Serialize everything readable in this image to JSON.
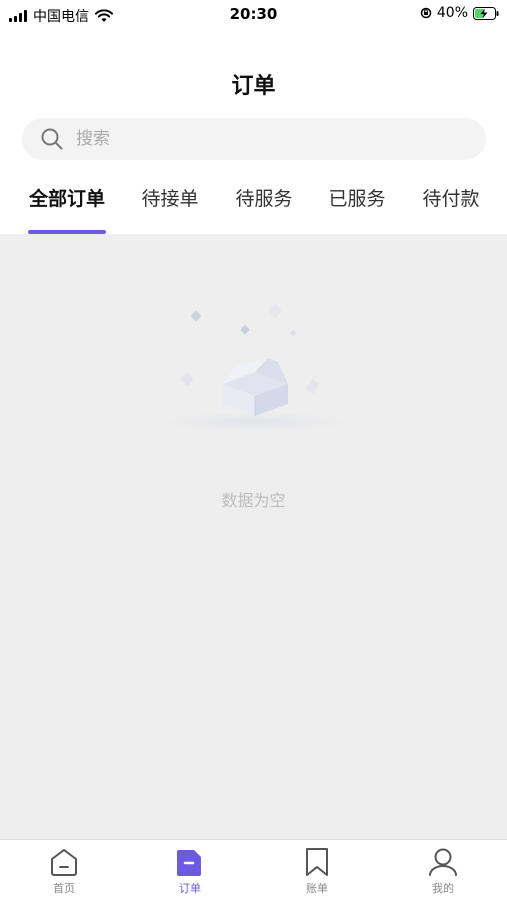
{
  "status_bar": {
    "carrier": "中国电信",
    "time": "20:30",
    "battery": "40%"
  },
  "page_title": "订单",
  "search": {
    "placeholder": "搜索"
  },
  "tabs": [
    {
      "label": "全部订单",
      "active": true
    },
    {
      "label": "待接单",
      "active": false
    },
    {
      "label": "待服务",
      "active": false
    },
    {
      "label": "已服务",
      "active": false
    },
    {
      "label": "待付款",
      "active": false
    }
  ],
  "empty_state": {
    "text": "数据为空"
  },
  "tab_bar": {
    "items": [
      {
        "label": "首页",
        "icon": "home-icon",
        "active": false
      },
      {
        "label": "订单",
        "icon": "order-icon",
        "active": true
      },
      {
        "label": "账单",
        "icon": "bookmark-icon",
        "active": false
      },
      {
        "label": "我的",
        "icon": "person-icon",
        "active": false
      }
    ]
  },
  "colors": {
    "accent": "#6b5be0",
    "content_bg": "#eeeeee",
    "search_bg": "#f3f3f3",
    "empty_text": "#bdbdbd"
  }
}
